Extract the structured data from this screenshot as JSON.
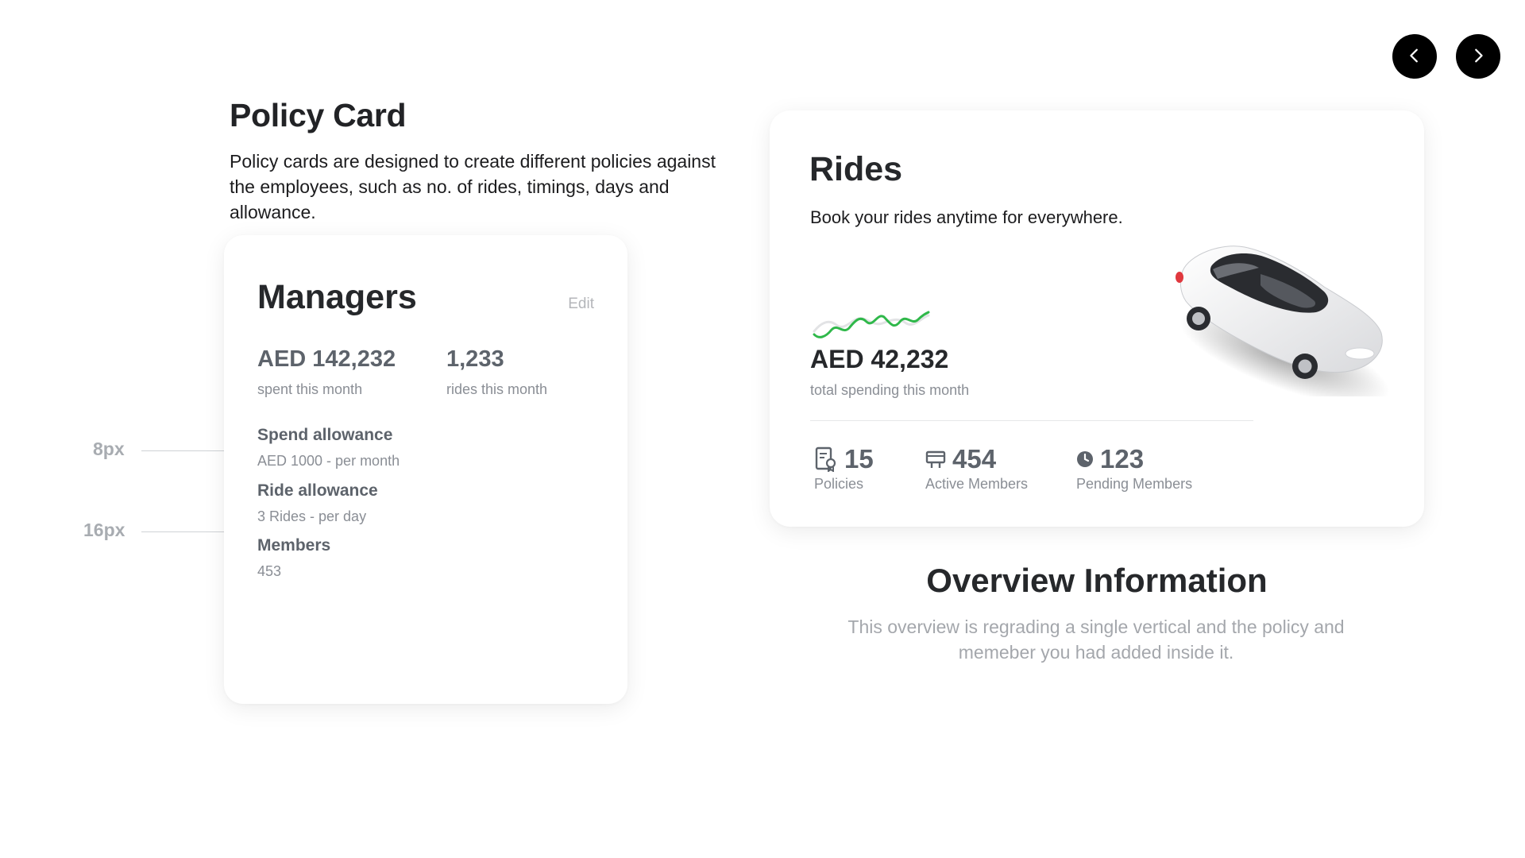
{
  "nav": {
    "prev_icon": "chevron-left-icon",
    "next_icon": "chevron-right-icon"
  },
  "intro": {
    "title": "Policy Card",
    "description": "Policy cards are designed to create different policies against the employees, such as no. of rides, timings, days and allowance."
  },
  "policy_card": {
    "title": "Managers",
    "edit_label": "Edit",
    "stats": [
      {
        "value": "AED 142,232",
        "label": "spent this month"
      },
      {
        "value": "1,233",
        "label": "rides this month"
      }
    ],
    "items": [
      {
        "title": "Spend allowance",
        "value": "AED 1000 - per month"
      },
      {
        "title": "Ride allowance",
        "value": "3 Rides - per day"
      },
      {
        "title": "Members",
        "value": "453"
      }
    ]
  },
  "annotations": [
    {
      "label": "8px"
    },
    {
      "label": "16px"
    }
  ],
  "rides_card": {
    "title": "Rides",
    "subtitle": "Book your rides anytime for everywhere.",
    "amount": "AED 42,232",
    "amount_label": "total spending this month",
    "accent_color": "#2fb84a",
    "metrics": [
      {
        "icon": "policy-document-icon",
        "value": "15",
        "label": "Policies"
      },
      {
        "icon": "members-card-icon",
        "value": "454",
        "label": "Active Members"
      },
      {
        "icon": "clock-icon",
        "value": "123",
        "label": "Pending Members"
      }
    ]
  },
  "overview": {
    "title": "Overview Information",
    "description": "This overview is regrading a single vertical and the policy and memeber you had added inside it."
  }
}
